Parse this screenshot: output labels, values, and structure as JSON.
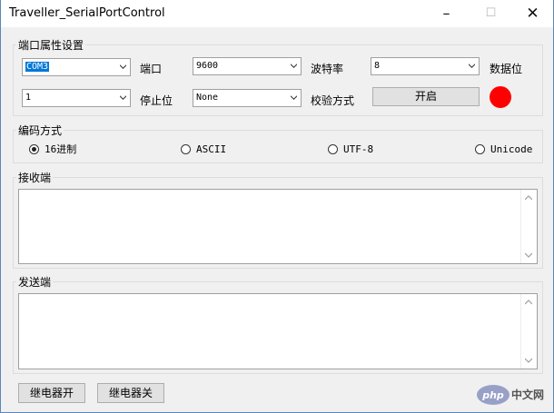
{
  "window": {
    "title": "Traveller_SerialPortControl"
  },
  "port_settings": {
    "group_title": "端口属性设置",
    "port_value": "COM3",
    "port_label": "端口",
    "baud_value": "9600",
    "baud_label": "波特率",
    "databits_value": "8",
    "databits_label": "数据位",
    "stopbits_value": "1",
    "stopbits_label": "停止位",
    "parity_value": "None",
    "parity_label": "校验方式",
    "open_button": "开启",
    "status_color": "#ff0000"
  },
  "encoding": {
    "group_title": "编码方式",
    "options": [
      "16进制",
      "ASCII",
      "UTF-8",
      "Unicode"
    ],
    "selected": "16进制"
  },
  "receive": {
    "group_title": "接收端",
    "text": ""
  },
  "send": {
    "group_title": "发送端",
    "text": ""
  },
  "footer": {
    "relay_on": "继电器开",
    "relay_off": "继电器关",
    "watermark": "php中文网"
  }
}
